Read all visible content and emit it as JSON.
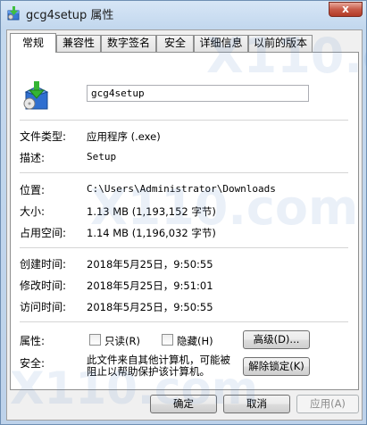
{
  "window": {
    "title": "gcg4setup 属性",
    "close_symbol": "x",
    "app_icon": "setup-box-icon"
  },
  "tabs": [
    {
      "label": "常规",
      "active": true
    },
    {
      "label": "兼容性",
      "active": false
    },
    {
      "label": "数字签名",
      "active": false
    },
    {
      "label": "安全",
      "active": false
    },
    {
      "label": "详细信息",
      "active": false
    },
    {
      "label": "以前的版本",
      "active": false
    }
  ],
  "general": {
    "file_name": "gcg4setup",
    "file_type_label": "文件类型:",
    "file_type_value": "应用程序 (.exe)",
    "description_label": "描述:",
    "description_value": "Setup",
    "location_label": "位置:",
    "location_value": "C:\\Users\\Administrator\\Downloads",
    "size_label": "大小:",
    "size_value": "1.13 MB (1,193,152 字节)",
    "size_on_disk_label": "占用空间:",
    "size_on_disk_value": "1.14 MB (1,196,032 字节)",
    "created_label": "创建时间:",
    "created_value": "2018年5月25日，9:50:55",
    "modified_label": "修改时间:",
    "modified_value": "2018年5月25日，9:51:01",
    "accessed_label": "访问时间:",
    "accessed_value": "2018年5月25日，9:50:55",
    "attributes_label": "属性:",
    "readonly_label": "只读(R)",
    "readonly_checked": false,
    "hidden_label": "隐藏(H)",
    "hidden_checked": false,
    "advanced_button": "高级(D)...",
    "security_label": "安全:",
    "security_text": "此文件来自其他计算机，可能被阻止以帮助保护该计算机。",
    "unblock_button": "解除锁定(K)"
  },
  "footer": {
    "ok_button": "确定",
    "cancel_button": "取消",
    "apply_button": "应用(A)",
    "apply_enabled": false
  },
  "watermark": {
    "text": "X110.com"
  },
  "colors": {
    "title_bar": "#c3d8ee",
    "close_button": "#c75a48",
    "panel_background": "#ffffff"
  }
}
